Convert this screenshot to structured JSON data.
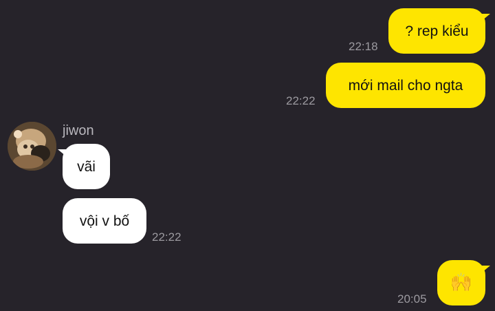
{
  "messages": [
    {
      "direction": "outgoing",
      "text": "? rep kiểu",
      "time": "22:18"
    },
    {
      "direction": "outgoing",
      "text": "mới mail cho ngta",
      "time": "22:22"
    },
    {
      "direction": "incoming",
      "sender": "jiwon",
      "text": "vãi"
    },
    {
      "direction": "incoming",
      "text": "vội v bố",
      "time": "22:22"
    },
    {
      "direction": "outgoing",
      "text": "🙌",
      "time": "20:05"
    }
  ],
  "colors": {
    "background": "#26232a",
    "outgoing_bubble": "#fee500",
    "incoming_bubble": "#ffffff",
    "timestamp": "#9c9aa0"
  }
}
